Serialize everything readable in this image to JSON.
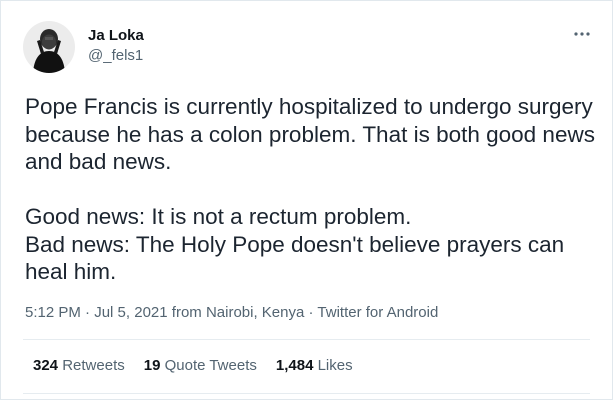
{
  "author": {
    "display_name": "Ja Loka",
    "handle": "@_fels1",
    "avatar_icon": "user-avatar-icon"
  },
  "menu": {
    "more_icon": "more-options-icon",
    "more_label": "···"
  },
  "tweet": {
    "paragraph_1": "Pope Francis is currently hospitalized to undergo surgery because he has a colon problem. That is both good news and bad news.",
    "line_good": "Good news: It is not a rectum problem.",
    "line_bad": "Bad news: The Holy Pope doesn't believe prayers can heal him."
  },
  "meta": {
    "time": "5:12 PM",
    "sep1": " · ",
    "date": "Jul 5, 2021",
    "location": " from Nairobi, Kenya",
    "sep2": " · ",
    "client": "Twitter for Android"
  },
  "stats": {
    "retweets_count": "324",
    "retweets_label": "Retweets",
    "quotes_count": "19",
    "quotes_label": "Quote Tweets",
    "likes_count": "1,484",
    "likes_label": "Likes"
  },
  "colors": {
    "text_primary": "#0f1419",
    "text_secondary": "#536471",
    "border": "#e1e8ed"
  }
}
